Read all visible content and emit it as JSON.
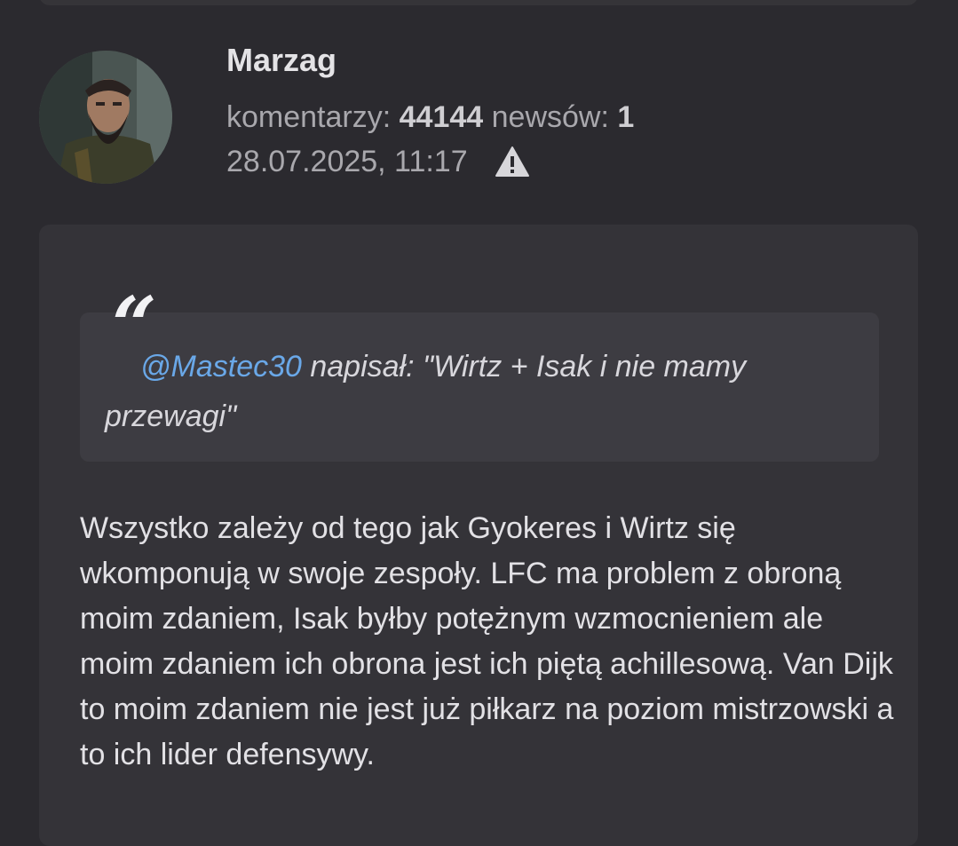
{
  "comment": {
    "author": {
      "username": "Marzag",
      "avatar_icon": "user-avatar-photo",
      "comments_label": "komentarzy:",
      "comments_count": "44144",
      "news_label": "newsów:",
      "news_count": "1"
    },
    "timestamp": "28.07.2025, 11:17",
    "report_icon": "warning-triangle-icon",
    "quote": {
      "mention": "@Mastec30",
      "text": " napisał: \"Wirtz + Isak i nie mamy przewagi\""
    },
    "body": "Wszystko zależy od tego jak Gyokeres i Wirtz się wkomponują w swoje zespoły. LFC ma problem z obroną moim zdaniem, Isak byłby potężnym wzmocnieniem ale moim zdaniem ich obrona jest ich piętą achillesową. Van Dijk to moim zdaniem nie jest już piłkarz na poziom mistrzowski a to ich lider defensywy."
  },
  "colors": {
    "background": "#2b2a2f",
    "card": "#343338",
    "quote_box": "#3d3c42",
    "mention": "#6aa8e8",
    "muted_text": "#a9a8ad"
  }
}
